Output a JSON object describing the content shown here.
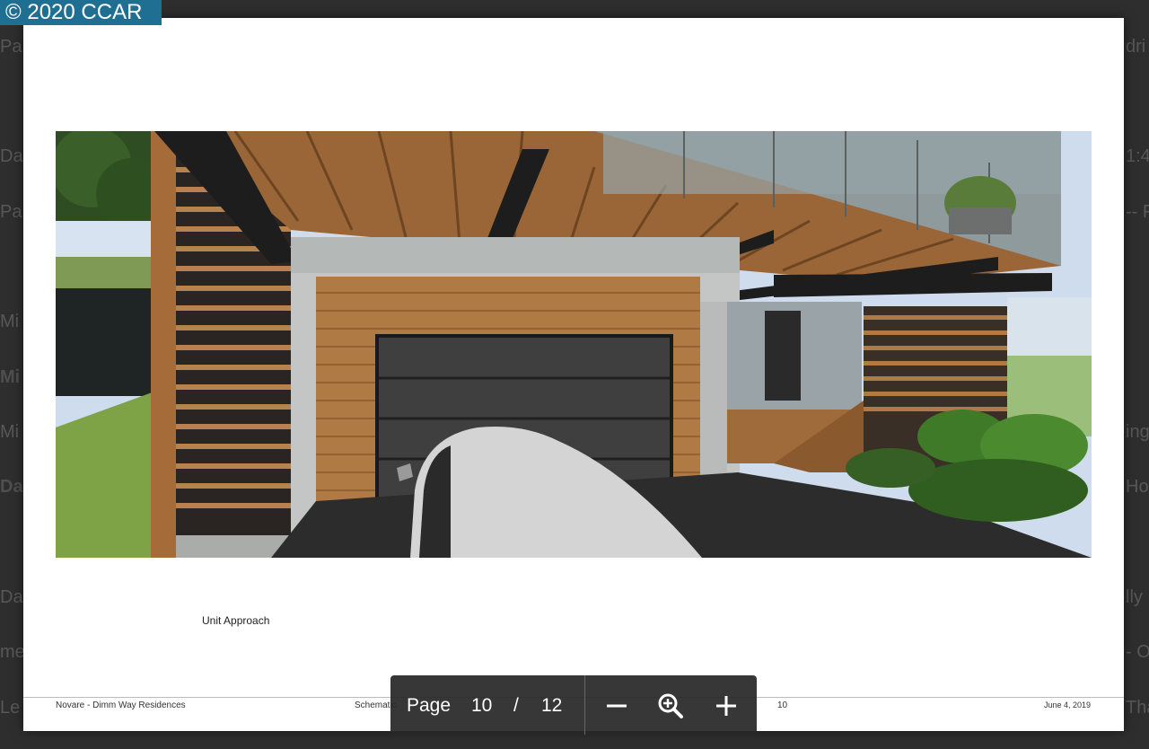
{
  "badge": {
    "text": "© 2020  CCAR"
  },
  "background_fragments": [
    {
      "id": "l1",
      "text": "Pa"
    },
    {
      "id": "l2",
      "text": "Da"
    },
    {
      "id": "l3",
      "text": "Pa"
    },
    {
      "id": "l4",
      "text": "Mi"
    },
    {
      "id": "l5",
      "text": "Mi"
    },
    {
      "id": "l6",
      "text": "Mi"
    },
    {
      "id": "l7",
      "text": "Da"
    },
    {
      "id": "l8",
      "text": "Da"
    },
    {
      "id": "l9",
      "text": "me"
    },
    {
      "id": "l10",
      "text": "Le"
    },
    {
      "id": "r1",
      "text": "dri"
    },
    {
      "id": "r2",
      "text": "1:4"
    },
    {
      "id": "r3",
      "text": "-- F"
    },
    {
      "id": "r4",
      "text": "ing"
    },
    {
      "id": "r5",
      "text": "Ho"
    },
    {
      "id": "r6",
      "text": "lly"
    },
    {
      "id": "r7",
      "text": "- Oi"
    },
    {
      "id": "r8",
      "text": "Tha"
    }
  ],
  "document": {
    "caption": "Unit Approach",
    "footer": {
      "project": "Novare - Dimm Way Residences",
      "sheet": "Schematic",
      "page_number": "10",
      "date": "June 4, 2019"
    }
  },
  "toolbar": {
    "page_label": "Page",
    "current_page": "10",
    "separator": "/",
    "total_pages": "12"
  },
  "colors": {
    "badge_bg": "#1f6f93",
    "toolbar_bg": "#282828",
    "wood": "#b07a45",
    "concrete": "#c3c6c4",
    "garage_door": "#3f3f3f",
    "foliage": "#3f7a28"
  }
}
